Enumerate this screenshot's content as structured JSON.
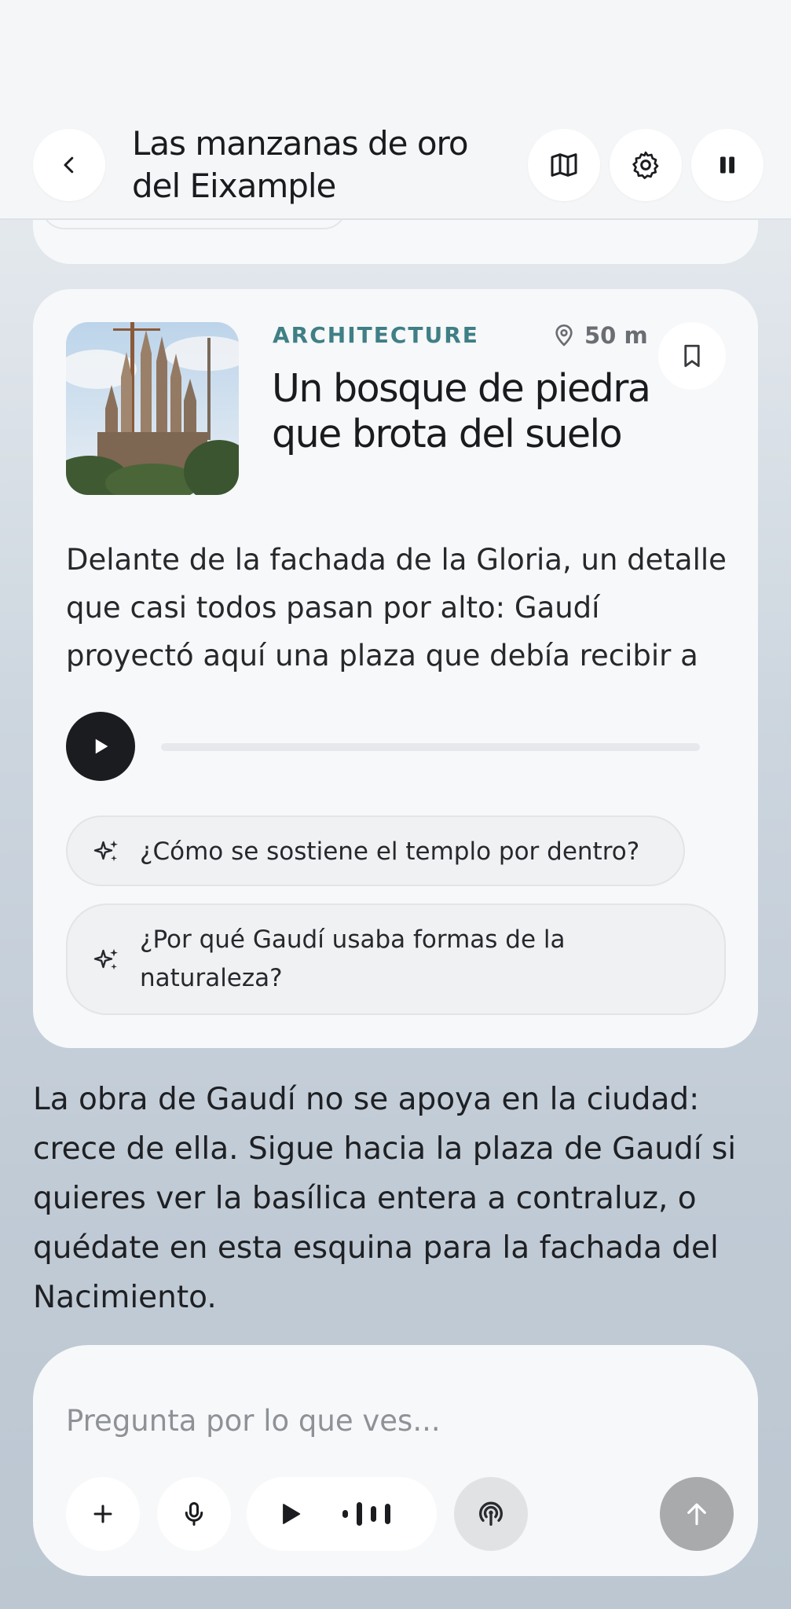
{
  "header": {
    "title": "Las manzanas de oro del Eixample",
    "back_icon": "chevron-left-icon",
    "map_icon": "map-icon",
    "settings_icon": "gear-icon",
    "pause_icon": "pause-icon"
  },
  "card": {
    "category": "ARCHITECTURE",
    "distance": "50 m",
    "title": "Un bosque de piedra que brota del suelo",
    "body": "Delante de la fachada de la Gloria, un detalle que casi todos pasan por alto: Gaudí proyectó aquí una plaza que debía recibir a l...",
    "audio_progress": 0,
    "suggestions": [
      "¿Cómo se sostiene el templo por dentro?",
      "¿Por qué Gaudí usaba formas de la naturaleza?"
    ]
  },
  "response": "La obra de Gaudí no se apoya en la ciudad: crece de ella. Sigue hacia la plaza de Gaudí si quieres ver la basílica entera a contraluz, o quédate en esta esquina para la fachada del Nacimiento.",
  "composer": {
    "placeholder": "Pregunta por lo que ves...",
    "icons": [
      "plus-icon",
      "microphone-icon",
      "play-icon",
      "waveform-icon",
      "broadcast-icon",
      "arrow-up-icon"
    ]
  },
  "colors": {
    "category": "#3f7f86",
    "play_button": "#1b1c1f",
    "send_button_disabled": "#a9aaac"
  }
}
